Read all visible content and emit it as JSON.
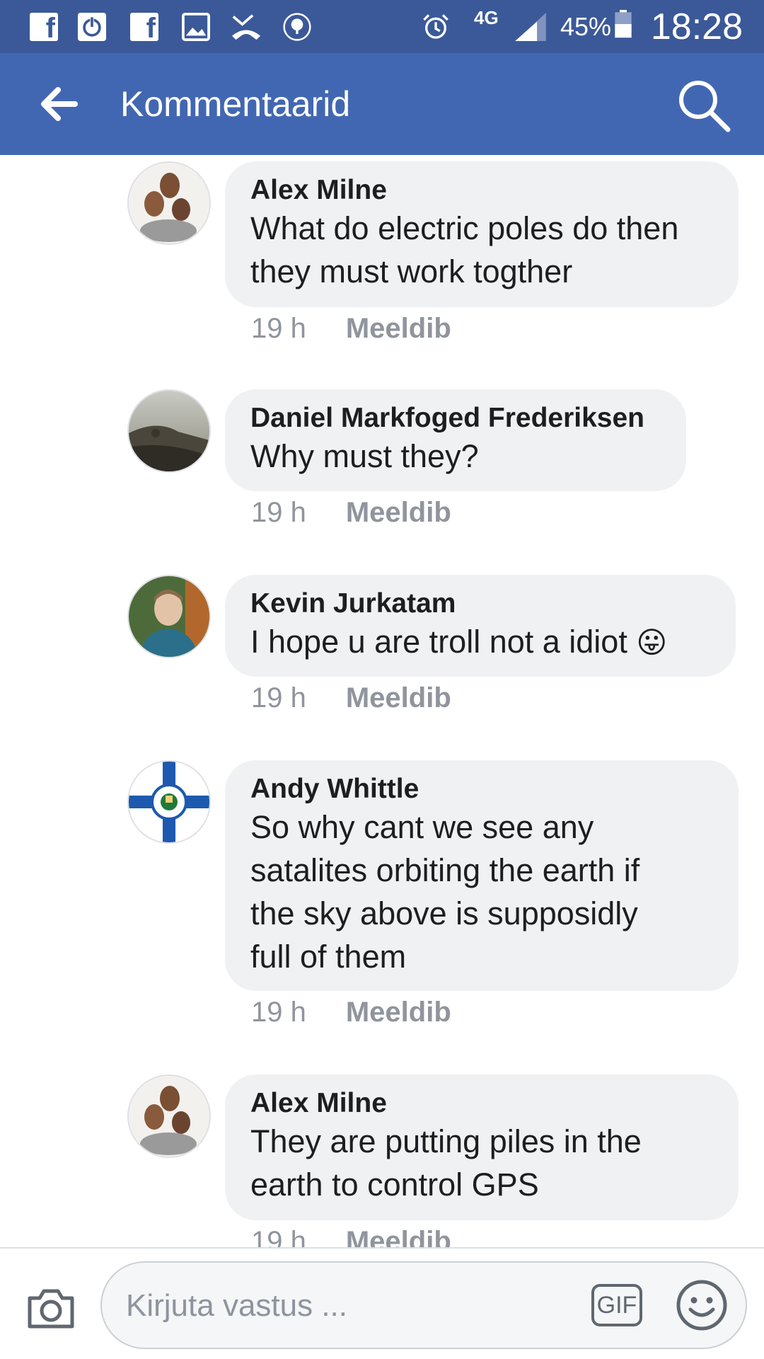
{
  "status_bar": {
    "network": "4G",
    "battery_percent": "45%",
    "battery_level": 0.45,
    "time": "18:28",
    "notification_icons": [
      "facebook-icon",
      "power-icon",
      "facebook-icon",
      "gallery-icon",
      "missed-call-icon",
      "badge-logo-icon"
    ]
  },
  "header": {
    "title": "Kommentaarid",
    "bg_color": "#4267b2"
  },
  "comments": [
    {
      "author": "Alex Milne",
      "text_lines": [
        "What do electric poles do then",
        "they must work togther"
      ],
      "time": "19 h",
      "like_label": "Meeldib"
    },
    {
      "author": "Daniel Markfoged Frederiksen",
      "text_lines": [
        "Why must they?"
      ],
      "time": "19 h",
      "like_label": "Meeldib"
    },
    {
      "author": "Kevin Jurkatam",
      "text_lines": [
        "I hope u are troll not a idiot"
      ],
      "emoji": "😛",
      "time": "19 h",
      "like_label": "Meeldib"
    },
    {
      "author": "Andy Whittle",
      "text_lines": [
        "So why cant we see any",
        "satalites orbiting the earth if",
        "the sky above is supposidly",
        "full of them"
      ],
      "time": "19 h",
      "like_label": "Meeldib"
    },
    {
      "author": "Alex Milne",
      "text_lines": [
        "They are putting piles in the",
        "earth to control GPS"
      ],
      "time": "19 h",
      "like_label": "Meeldib"
    }
  ],
  "compose": {
    "placeholder": "Kirjuta vastus ...",
    "gif_label": "GIF"
  }
}
